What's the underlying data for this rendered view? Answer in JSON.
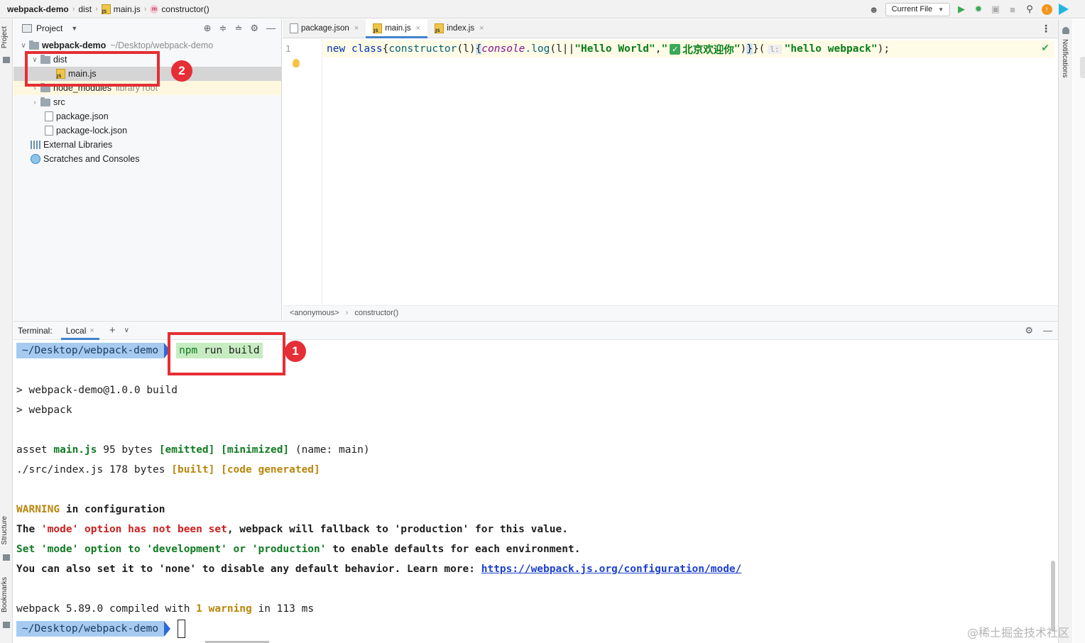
{
  "navbar": {
    "crumbs": [
      "webpack-demo",
      "dist",
      "main.js",
      "constructor()"
    ],
    "run_config": "Current File"
  },
  "left_stripe": {
    "top_label": "Project",
    "mid_label": "Structure",
    "bottom_label": "Bookmarks"
  },
  "right_stripe": {
    "label": "Notifications"
  },
  "project": {
    "header": "Project",
    "tree": {
      "root_name": "webpack-demo",
      "root_path": "~/Desktop/webpack-demo",
      "dist": "dist",
      "main_js": "main.js",
      "node_modules": "node_modules",
      "library_root": "library root",
      "src": "src",
      "package_json": "package.json",
      "package_lock": "package-lock.json",
      "external_libraries": "External Libraries",
      "scratches": "Scratches and Consoles"
    }
  },
  "editor": {
    "tabs": [
      "package.json",
      "main.js",
      "index.js"
    ],
    "line_number": "1",
    "code": {
      "new": "new",
      "class": "class",
      "constructor": "constructor",
      "paren1": "(",
      "l1": "l",
      "paren2": ")",
      "brace_open": "{",
      "console": "console",
      "dot_log": ".log",
      "paren3": "(",
      "l2": "l",
      "pipes": "||",
      "hello_world": "\"Hello World\"",
      "comma1": ",",
      "cn_quote_open": "\"",
      "check": "✓",
      "cn_text": "北京欢迎你",
      "cn_quote_close": "\"",
      "paren4": ")",
      "brace_close": "}",
      "close_brace2": "}",
      "paren5": "(",
      "inlay_hint": "l:",
      "hello_webpack": "\"hello webpack\"",
      "end": ");"
    },
    "breadcrumb": [
      "<anonymous>",
      "constructor()"
    ]
  },
  "terminal": {
    "label": "Terminal:",
    "tab": "Local",
    "prompt_path": "~/Desktop/webpack-demo",
    "command_npm": "npm",
    "command_rest": " run build",
    "lines": {
      "l1": "> webpack-demo@1.0.0 build",
      "l2": "> webpack",
      "asset_pre": "asset ",
      "asset_name": "main.js",
      "asset_size": " 95 bytes ",
      "emitted": "[emitted]",
      "minimized": "[minimized]",
      "asset_post": " (name: main)",
      "src_pre": "./src/index.js 178 bytes ",
      "built": "[built]",
      "code_generated": "[code generated]",
      "warning_word": "WARNING",
      "warning_rest": " in configuration",
      "mode_1": "The ",
      "mode_2": "'mode' option has not been set",
      "mode_3": ", webpack will fallback to 'production' for this value.",
      "set_1": "Set 'mode' option to 'development' or 'production'",
      "set_2": " to enable defaults for each environment.",
      "also_1": "You can also set it to 'none' to disable any default behavior. Learn more: ",
      "also_link": "https://webpack.js.org/configuration/mode/",
      "compiled_1": "webpack 5.89.0 compiled with ",
      "compiled_2": "1 warning",
      "compiled_3": " in 113 ms"
    }
  },
  "annotations": {
    "badge1": "1",
    "badge2": "2",
    "color": "#e52e35"
  },
  "watermark": "@稀土掘金技术社区"
}
